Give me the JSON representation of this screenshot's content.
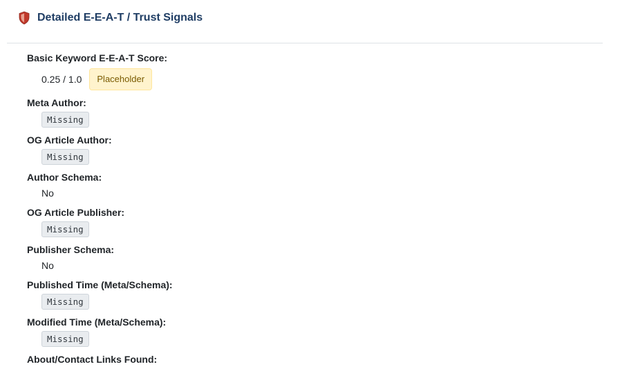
{
  "header": {
    "title": "Detailed E-E-A-T / Trust Signals",
    "icon": "shield-icon",
    "icon_color": "#c0392b"
  },
  "score": {
    "label": "Basic Keyword E-E-A-T Score:",
    "value": "0.25 / 1.0",
    "badge": "Placeholder"
  },
  "fields": [
    {
      "label": "Meta Author:",
      "value": "Missing",
      "style": "code"
    },
    {
      "label": "OG Article Author:",
      "value": "Missing",
      "style": "code"
    },
    {
      "label": "Author Schema:",
      "value": "No",
      "style": "plain"
    },
    {
      "label": "OG Article Publisher:",
      "value": "Missing",
      "style": "code"
    },
    {
      "label": "Publisher Schema:",
      "value": "No",
      "style": "plain"
    },
    {
      "label": "Published Time (Meta/Schema):",
      "value": "Missing",
      "style": "code"
    },
    {
      "label": "Modified Time (Meta/Schema):",
      "value": "Missing",
      "style": "code"
    },
    {
      "label": "About/Contact Links Found:",
      "value": "",
      "style": "plain"
    }
  ],
  "colors": {
    "title": "#1f3d64",
    "placeholder_bg": "#fff3cd",
    "code_bg": "#e9ecef"
  }
}
